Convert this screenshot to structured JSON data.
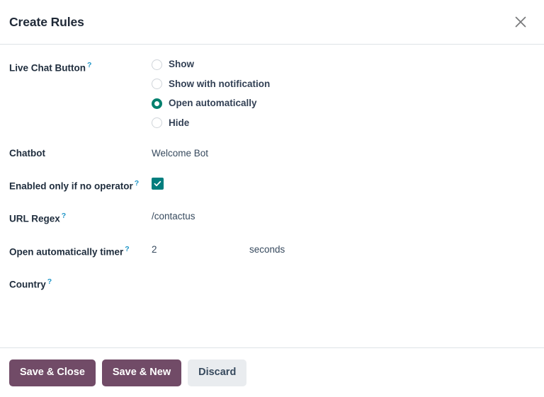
{
  "dialog": {
    "title": "Create Rules",
    "close_icon": "close-icon"
  },
  "form": {
    "live_chat_button": {
      "label": "Live Chat Button",
      "help": "?",
      "options": [
        {
          "label": "Show",
          "selected": false
        },
        {
          "label": "Show with notification",
          "selected": false
        },
        {
          "label": "Open automatically",
          "selected": true
        },
        {
          "label": "Hide",
          "selected": false
        }
      ]
    },
    "chatbot": {
      "label": "Chatbot",
      "value": "Welcome Bot"
    },
    "enabled_only_if_no_operator": {
      "label": "Enabled only if no operator",
      "help": "?",
      "checked": true,
      "check_icon": "check-icon"
    },
    "url_regex": {
      "label": "URL Regex",
      "help": "?",
      "value": "/contactus"
    },
    "open_automatically_timer": {
      "label": "Open automatically timer",
      "help": "?",
      "value": "2",
      "unit": "seconds"
    },
    "country": {
      "label": "Country",
      "help": "?",
      "value": ""
    }
  },
  "footer": {
    "save_close_label": "Save & Close",
    "save_new_label": "Save & New",
    "discard_label": "Discard"
  },
  "colors": {
    "accent_teal": "#017e7e",
    "radio_selected": "#00806e",
    "primary_button": "#714b67",
    "secondary_button": "#e9ecef",
    "help_mark": "#2196c7",
    "text": "#1f2d3d"
  }
}
